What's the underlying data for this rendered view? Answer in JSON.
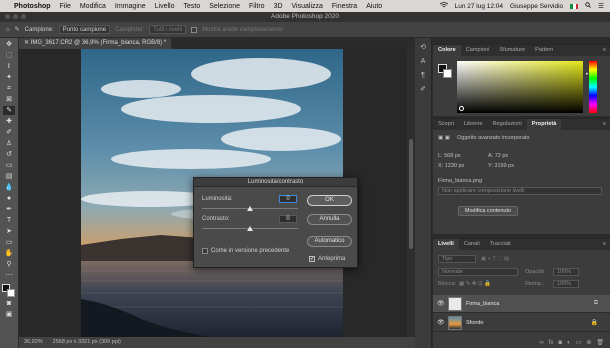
{
  "menubar": {
    "app": "Photoshop",
    "items": [
      "File",
      "Modifica",
      "Immagine",
      "Livello",
      "Testo",
      "Selezione",
      "Filtro",
      "3D",
      "Visualizza",
      "Finestra",
      "Aiuto"
    ],
    "datetime": "Lun 27 lug 12:04",
    "user": "Giuseppe Servidio"
  },
  "window": {
    "title": "Adobe Photoshop 2020"
  },
  "options": {
    "sample_label": "Campione:",
    "sample_value": "Punto campione",
    "sample2_label": "Campione:",
    "sample2_value": "Tutti i livelli",
    "ring": "Mostra anello campionamento"
  },
  "document": {
    "tab": "IMG_3617.CR2 @ 36,9% (Firma_bianca, RGB/8) *",
    "zoom": "36,92%",
    "info": "2568 px x 3321 px (300 ppi)"
  },
  "dialog": {
    "title": "Luminosità/contrasto",
    "brightness_label": "Luminosità:",
    "brightness_value": "0",
    "brightness_level": 0.5,
    "contrast_label": "Contrasto:",
    "contrast_value": "0",
    "contrast_level": 0.5,
    "legacy_label": "Come in versione precedente",
    "legacy_checked": false,
    "preview_label": "Anteprima",
    "preview_checked": true,
    "ok_label": "OK",
    "cancel_label": "Annulla",
    "auto_label": "Automatico"
  },
  "color_panel": {
    "tabs": [
      "Colore",
      "Campioni",
      "Sfumature",
      "Pattern"
    ],
    "active": 0,
    "hue_color": "#e3e61a"
  },
  "properties_panel": {
    "tabs": [
      "Scopri",
      "Librerie",
      "Regolazioni",
      "Proprietà"
    ],
    "active": 3,
    "object_type": "Oggetto avanzato incorporato",
    "w": "L: 568 px",
    "h": "A: 72 px",
    "x": "X: 1230 px",
    "y": "Y: 3199 px",
    "filename": "Firma_bianca.png",
    "comp_placeholder": "Non applicare composizione livelli",
    "edit_button": "Modifica contenuto"
  },
  "layers_panel": {
    "tabs": [
      "Livelli",
      "Canali",
      "Tracciati"
    ],
    "active": 0,
    "kind": "Tipo",
    "blend": "Normale",
    "opacity_label": "Opacità:",
    "opacity": "100%",
    "lock_label": "Blocca:",
    "fill_label": "Riemp.:",
    "fill": "100%",
    "layers": [
      {
        "name": "Firma_bianca",
        "selected": true
      },
      {
        "name": "Sfondo",
        "selected": false
      }
    ]
  }
}
